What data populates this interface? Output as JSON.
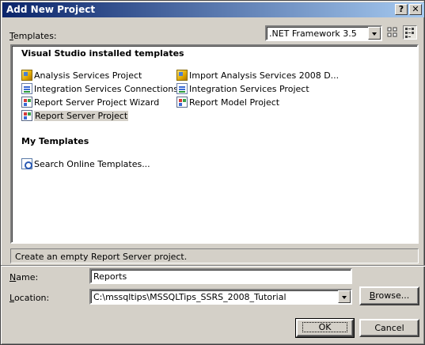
{
  "window": {
    "title": "Add New Project",
    "help_label": "?",
    "close_label": "✕"
  },
  "templates_label": {
    "pre": "",
    "accel": "T",
    "post": "emplates:"
  },
  "framework": {
    "selected": ".NET Framework 3.5"
  },
  "view_buttons": [
    {
      "name": "large-icons-view",
      "active": false
    },
    {
      "name": "small-icons-view",
      "active": true
    }
  ],
  "sections": {
    "installed": "Visual Studio installed templates",
    "my": "My Templates"
  },
  "installed_templates": [
    {
      "label": "Analysis Services Project",
      "icon": "analysis-cube-icon",
      "selected": false
    },
    {
      "label": "Import Analysis Services 2008 D...",
      "icon": "analysis-cube-icon",
      "selected": false
    },
    {
      "label": "Integration Services Connections...",
      "icon": "integration-package-icon",
      "selected": false
    },
    {
      "label": "Integration Services Project",
      "icon": "integration-package-icon",
      "selected": false
    },
    {
      "label": "Report Server Project Wizard",
      "icon": "report-wizard-icon",
      "selected": false
    },
    {
      "label": "Report Model Project",
      "icon": "report-model-icon",
      "selected": false
    },
    {
      "label": "Report Server Project",
      "icon": "report-project-icon",
      "selected": true
    }
  ],
  "my_templates": [
    {
      "label": "Search Online Templates...",
      "icon": "search-online-icon"
    }
  ],
  "status_text": "Create an empty Report Server project.",
  "name_field": {
    "label_accel": "N",
    "label_rest": "ame:",
    "value": "Reports"
  },
  "location_field": {
    "label_accel": "L",
    "label_rest": "ocation:",
    "value": "C:\\mssqltips\\MSSQLTips_SSRS_2008_Tutorial"
  },
  "buttons": {
    "browse": {
      "accel": "B",
      "rest": "rowse..."
    },
    "ok": "OK",
    "cancel": "Cancel"
  }
}
